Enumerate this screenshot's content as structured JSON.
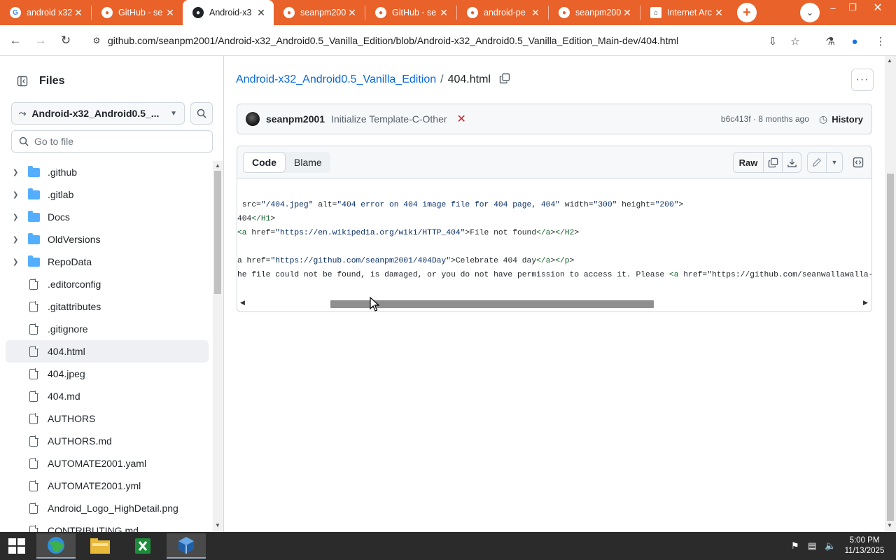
{
  "browser": {
    "tabs": [
      {
        "title": "android x32",
        "favicon": "google-icon",
        "active": false
      },
      {
        "title": "GitHub - se",
        "favicon": "github-icon",
        "active": false
      },
      {
        "title": "Android-x3",
        "favicon": "github-icon",
        "active": true
      },
      {
        "title": "seanpm200",
        "favicon": "github-icon",
        "active": false
      },
      {
        "title": "GitHub - se",
        "favicon": "github-icon",
        "active": false
      },
      {
        "title": "android-pe",
        "favicon": "github-icon",
        "active": false
      },
      {
        "title": "seanpm200",
        "favicon": "github-icon",
        "active": false
      },
      {
        "title": "Internet Arc",
        "favicon": "internet-archive-icon",
        "active": false
      }
    ],
    "url": "github.com/seanpm2001/Android-x32_Android0.5_Vanilla_Edition/blob/Android-x32_Android0.5_Vanilla_Edition_Main-dev/404.html",
    "accent": "#e8622a"
  },
  "sidebar": {
    "title": "Files",
    "branch": "Android-x32_Android0.5_...",
    "goto_placeholder": "Go to file",
    "items": [
      {
        "name": ".github",
        "type": "folder"
      },
      {
        "name": ".gitlab",
        "type": "folder"
      },
      {
        "name": "Docs",
        "type": "folder"
      },
      {
        "name": "OldVersions",
        "type": "folder"
      },
      {
        "name": "RepoData",
        "type": "folder"
      },
      {
        "name": ".editorconfig",
        "type": "file"
      },
      {
        "name": ".gitattributes",
        "type": "file"
      },
      {
        "name": ".gitignore",
        "type": "file"
      },
      {
        "name": "404.html",
        "type": "file",
        "selected": true
      },
      {
        "name": "404.jpeg",
        "type": "file"
      },
      {
        "name": "404.md",
        "type": "file"
      },
      {
        "name": "AUTHORS",
        "type": "file"
      },
      {
        "name": "AUTHORS.md",
        "type": "file"
      },
      {
        "name": "AUTOMATE2001.yaml",
        "type": "file"
      },
      {
        "name": "AUTOMATE2001.yml",
        "type": "file"
      },
      {
        "name": "Android_Logo_HighDetail.png",
        "type": "file"
      },
      {
        "name": "CONTRIBUTING.md",
        "type": "file"
      }
    ]
  },
  "breadcrumb": {
    "repo": "Android-x32_Android0.5_Vanilla_Edition",
    "separator": "/",
    "file": "404.html"
  },
  "commit": {
    "author": "seanpm2001",
    "message": "Initialize Template-C-Other",
    "status": "✕",
    "status_color": "#cf222e",
    "meta": "b6c413f · 8 months ago",
    "history_label": "History"
  },
  "code_view": {
    "tabs": [
      "Code",
      "Blame"
    ],
    "active_tab": "Code",
    "raw_label": "Raw",
    "lines": [
      " src=\"/404.jpeg\" alt=\"404 error on 404 image file for 404 page, 404\" width=\"300\" height=\"200\">",
      "404</H1>",
      "<a href=\"https://en.wikipedia.org/wiki/HTTP_404\">File not found</a></H2>",
      "",
      "a href=\"https://github.com/seanpm2001/404Day\">Celebrate 404 day</a></p>",
      "he file could not be found, is damaged, or you do not have permission to access it. Please <a href=\"https://github.com/seanwallawalla-test"
    ],
    "horizontal_scroll_fraction": 0.36
  },
  "taskbar": {
    "clock_time": "5:00 PM",
    "clock_date": "11/13/2025"
  }
}
